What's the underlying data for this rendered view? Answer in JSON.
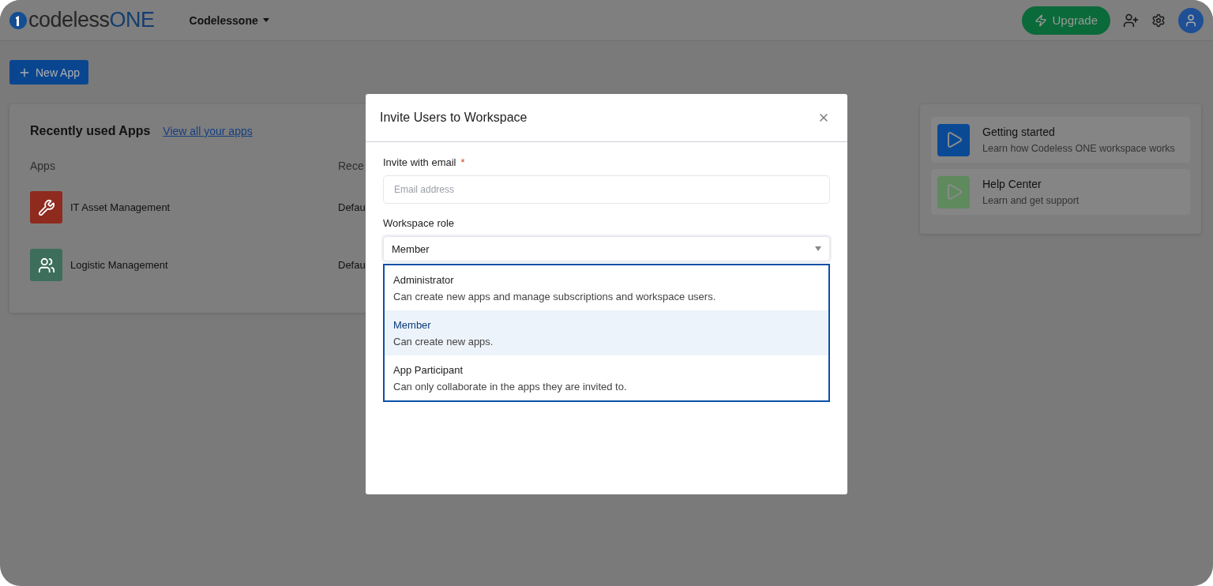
{
  "header": {
    "logo": {
      "text_main": "codeless",
      "text_accent": "ONE"
    },
    "workspace": "Codelessone",
    "upgrade": "Upgrade"
  },
  "new_app": "New App",
  "recent_apps": {
    "title": "Recently used Apps",
    "link": "View all your apps",
    "columns": [
      "Apps",
      "Rece"
    ],
    "rows": [
      {
        "name": "IT Asset Management",
        "column_2": "Defau",
        "color": "#8f2a1e",
        "kind": "tools"
      },
      {
        "name": "Logistic Management",
        "column_2": "Defau",
        "color": "#3d6e5b",
        "kind": "people"
      }
    ]
  },
  "resources": [
    {
      "title": "Getting started",
      "subtitle": "Learn how Codeless ONE workspace works",
      "color": "#0a4a95"
    },
    {
      "title": "Help Center",
      "subtitle": "Learn and get support",
      "color": "#5e8a5e"
    }
  ],
  "modal": {
    "title": "Invite Users to Workspace",
    "email_label": "Invite with email",
    "required_mark": "*",
    "email_placeholder": "Email address",
    "role_label": "Workspace role",
    "role_value": "Member",
    "role_options": [
      {
        "title": "Administrator",
        "description": "Can create new apps and manage subscriptions and workspace users.",
        "selected": false
      },
      {
        "title": "Member",
        "description": "Can create new apps.",
        "selected": true
      },
      {
        "title": "App Participant",
        "description": "Can only collaborate in the apps they are invited to.",
        "selected": false
      }
    ]
  }
}
